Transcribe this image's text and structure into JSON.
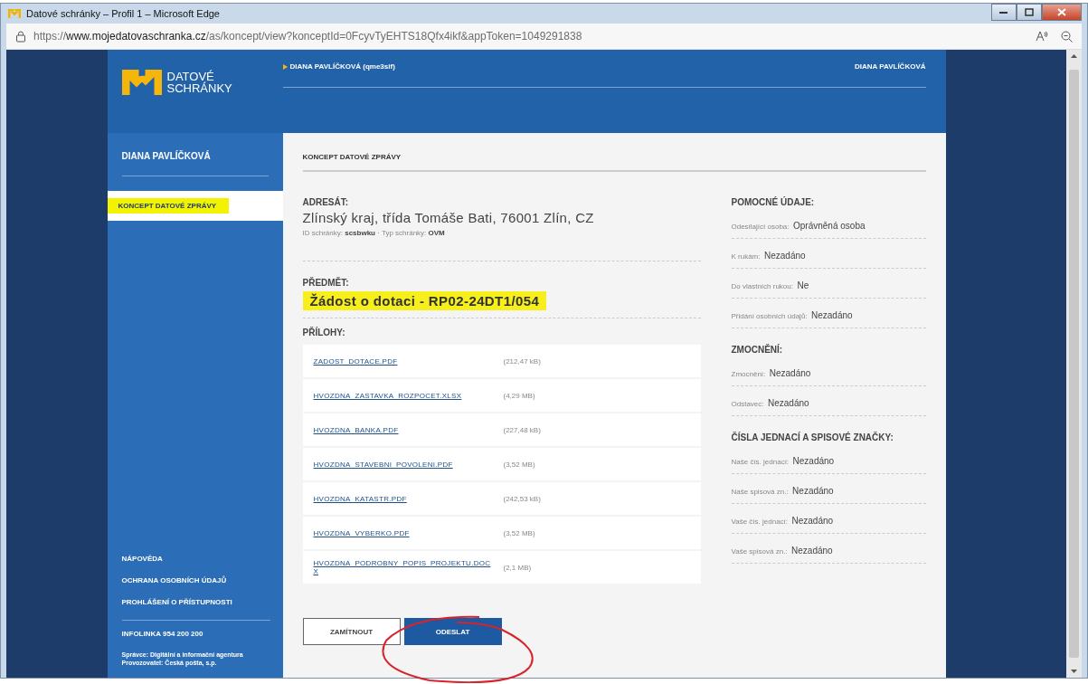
{
  "window": {
    "title": "Datové schránky – Profil 1 – Microsoft Edge"
  },
  "address_bar": {
    "url": "https://**www.mojedatovaschranka.cz**/as/koncept/view?konceptId=0FcyvTyEHTS18Qfx4ikf&appToken=1049291838"
  },
  "header": {
    "logo_lines": [
      "DATOVÉ",
      "SCHRÁNKY"
    ],
    "user_link": "DIANA PAVLÍČKOVÁ (qme3sif)",
    "user_name": "DIANA PAVLÍČKOVÁ"
  },
  "sidebar": {
    "title": "DIANA PAVLÍČKOVÁ",
    "items": [
      {
        "label": "KONCEPT DATOVÉ ZPRÁVY",
        "selected": true,
        "highlighted": true
      }
    ],
    "footer_links": [
      "NÁPOVĚDA",
      "OCHRANA OSOBNÍCH ÚDAJŮ",
      "PROHLÁŠENÍ O PŘÍSTUPNOSTI"
    ],
    "hotline": "INFOLINKA 954 200 200",
    "credits": [
      "Správce: Digitální a informační agentura",
      "Provozovatel: Česká pošta, s.p."
    ]
  },
  "main": {
    "title": "KONCEPT DATOVÉ ZPRÁVY",
    "recipient": {
      "label": "ADRESÁT:",
      "name": "Zlínský kraj, třída Tomáše Bati, 76001 Zlín, CZ",
      "details": "ID schránky: **scsbwku** · Typ schránky: **OVM**"
    },
    "subject": {
      "label": "PŘEDMĚT:",
      "text": "Žádost o dotaci - RP02-24DT1/054",
      "highlighted": true
    },
    "attachments": {
      "label": "PŘÍLOHY:",
      "files": [
        {
          "name": "ZADOST_DOTACE.PDF",
          "size": "(212,47 kB)"
        },
        {
          "name": "HVOZDNA_ZASTAVKA_ROZPOCET.XLSX",
          "size": "(4,29 MB)"
        },
        {
          "name": "HVOZDNA_BANKA.PDF",
          "size": "(227,48 kB)"
        },
        {
          "name": "HVOZDNA_STAVEBNI_POVOLENI.PDF",
          "size": "(3,52 MB)"
        },
        {
          "name": "HVOZDNA_KATASTR.PDF",
          "size": "(242,53 kB)"
        },
        {
          "name": "HVOZDNA_VYBERKO.PDF",
          "size": "(3,52 MB)"
        },
        {
          "name": "HVOZDNA_PODROBNY_POPIS_PROJEKTU.DOCX",
          "size": "(2,1 MB)"
        }
      ]
    },
    "buttons": [
      {
        "label": "ZAMÍTNOUT",
        "kind": "secondary"
      },
      {
        "label": "ODESLAT",
        "kind": "primary"
      }
    ]
  },
  "side_info": {
    "sections": [
      {
        "title": "POMOCNÉ ÚDAJE:",
        "fields": [
          {
            "label": "Odesílající osoba:",
            "value": "Oprávněná osoba"
          },
          {
            "label": "K rukám:",
            "value": "Nezadáno"
          },
          {
            "label": "Do vlastních rukou:",
            "value": "Ne"
          },
          {
            "label": "Přidání osobních údajů:",
            "value": "Nezadáno"
          }
        ]
      },
      {
        "title": "ZMOCNĚNÍ:",
        "fields": [
          {
            "label": "Zmocnění:",
            "value": "Nezadáno"
          },
          {
            "label": "Odstavec:",
            "value": "Nezadáno"
          }
        ]
      },
      {
        "title": "ČÍSLA JEDNACÍ A SPISOVÉ ZNAČKY:",
        "fields": [
          {
            "label": "Naše čís. jednací:",
            "value": "Nezadáno"
          },
          {
            "label": "Naše spisová zn.:",
            "value": "Nezadáno"
          },
          {
            "label": "Vaše čís. jednací:",
            "value": "Nezadáno"
          },
          {
            "label": "Vaše spisová zn.:",
            "value": "Nezadáno"
          }
        ]
      }
    ]
  }
}
